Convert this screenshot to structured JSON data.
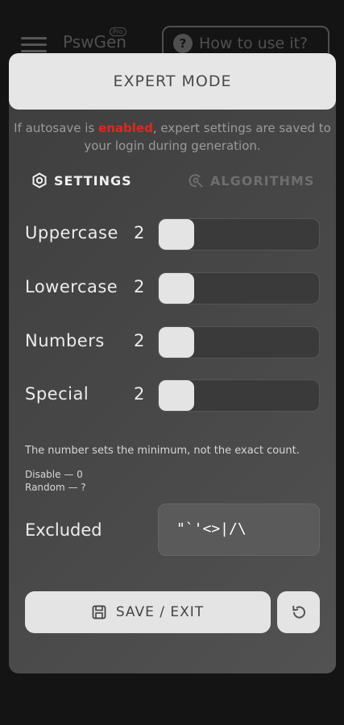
{
  "background": {
    "app_name": "PswGen",
    "badge": "Pro",
    "help_button": "How to use it?"
  },
  "modal": {
    "title": "EXPERT MODE",
    "note_prefix": "If autosave is ",
    "note_highlight": "enabled",
    "note_suffix": ", expert settings are saved to your login during generation.",
    "tabs": {
      "settings": "SETTINGS",
      "algorithms": "ALGORITHMS"
    },
    "rows": [
      {
        "label": "Uppercase",
        "count": "2"
      },
      {
        "label": "Lowercase",
        "count": "2"
      },
      {
        "label": "Numbers",
        "count": "2"
      },
      {
        "label": "Special",
        "count": "2"
      }
    ],
    "hint": "The number sets the minimum, not the exact count.",
    "disable_hint": "Disable — 0",
    "random_hint": "Random — ?",
    "excluded_label": "Excluded",
    "excluded_value": "\"`'<>|/\\",
    "save_label": "SAVE / EXIT"
  },
  "colors": {
    "accent_red": "#e0271f",
    "surface": "#474747",
    "header": "#e6e6e6"
  }
}
